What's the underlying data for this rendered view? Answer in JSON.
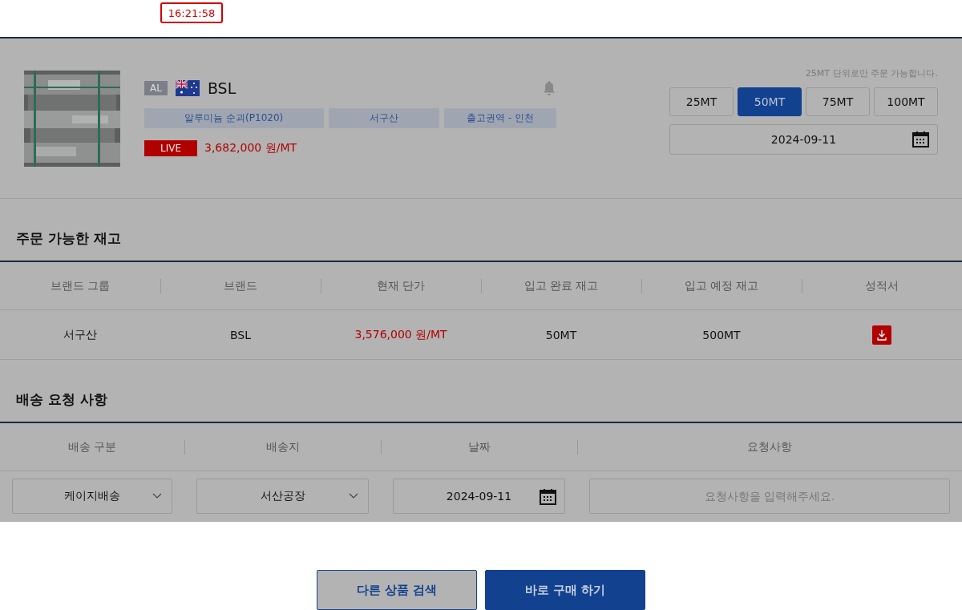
{
  "clock": "16:21:58",
  "product": {
    "metal": "AL",
    "name": "BSL",
    "tags": [
      "알루미늄 순괴(P1020)",
      "서구산",
      "출고권역 - 인천"
    ],
    "live": "LIVE",
    "price": "3,682,000 원/MT"
  },
  "order": {
    "note": "25MT 단위로만 주문 가능합니다.",
    "quantities": [
      {
        "label": "25MT",
        "selected": false
      },
      {
        "label": "50MT",
        "selected": true
      },
      {
        "label": "75MT",
        "selected": false
      },
      {
        "label": "100MT",
        "selected": false
      }
    ],
    "date": "2024-09-11"
  },
  "stock": {
    "title": "주문 가능한 재고",
    "columns": [
      "브랜드 그룹",
      "브랜드",
      "현재 단가",
      "입고 완료 재고",
      "입고 예정 재고",
      "성적서"
    ],
    "rows": [
      {
        "cells": [
          "서구산",
          "BSL",
          "3,576,000 원/MT",
          "50MT",
          "500MT"
        ]
      }
    ]
  },
  "delivery": {
    "title": "배송 요청 사항",
    "columns": [
      "배송 구분",
      "배송지",
      "날짜",
      "요청사항"
    ],
    "type": "케이지배송",
    "destination": "서산공장",
    "date": "2024-09-11",
    "request_placeholder": "요청사항을 입력해주세요."
  },
  "buttons": [
    {
      "label": "다른 상품 검색",
      "kind": "secondary"
    },
    {
      "label": "바로 구매 하기",
      "kind": "primary"
    }
  ]
}
